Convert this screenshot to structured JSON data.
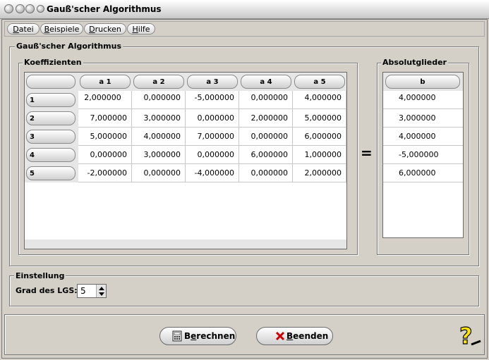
{
  "window": {
    "title": "Gauß'scher Algorithmus"
  },
  "menu": [
    {
      "label": "Datei",
      "mnemonic_index": 0
    },
    {
      "label": "Beispiele",
      "mnemonic_index": 0
    },
    {
      "label": "Drucken",
      "mnemonic_index": 0
    },
    {
      "label": "Hilfe",
      "mnemonic_index": 0
    }
  ],
  "main_group": {
    "label": "Gauß'scher Algorithmus"
  },
  "coeff_group": {
    "label": "Koeffizienten",
    "columns": [
      "a 1",
      "a 2",
      "a 3",
      "a 4",
      "a 5"
    ],
    "rows": [
      {
        "label": "1",
        "values": [
          "2,000000",
          "0,000000",
          "-5,000000",
          "0,000000",
          "4,000000"
        ]
      },
      {
        "label": "2",
        "values": [
          "7,000000",
          "3,000000",
          "0,000000",
          "2,000000",
          "5,000000"
        ]
      },
      {
        "label": "3",
        "values": [
          "5,000000",
          "4,000000",
          "7,000000",
          "0,000000",
          "6,000000"
        ]
      },
      {
        "label": "4",
        "values": [
          "0,000000",
          "3,000000",
          "0,000000",
          "6,000000",
          "1,000000"
        ]
      },
      {
        "label": "5",
        "values": [
          "-2,000000",
          "0,000000",
          "-4,000000",
          "0,000000",
          "2,000000"
        ]
      }
    ]
  },
  "equals_sign": "=",
  "abs_group": {
    "label": "Absolutglieder",
    "column": "b",
    "values": [
      "4,000000",
      "3,000000",
      "4,000000",
      "-5,000000",
      "6,000000"
    ]
  },
  "settings": {
    "label": "Einstellung",
    "degree_label": "Grad des LGS:",
    "degree_value": "5"
  },
  "buttons": {
    "calculate": "Berechnen",
    "quit": "Beenden"
  },
  "colors": {
    "background": "#d4d0c8",
    "quit_icon": "#cc0000",
    "help_icon": "#ffe600"
  },
  "icons": [
    "calculator-icon",
    "x-icon",
    "help-icon",
    "up-arrow-icon",
    "down-arrow-icon"
  ]
}
